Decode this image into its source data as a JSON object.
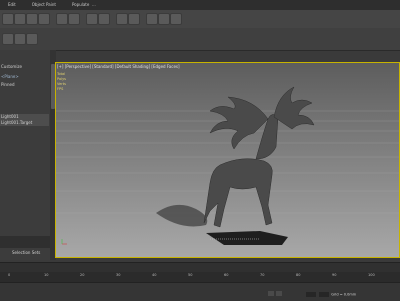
{
  "ribbon": {
    "tabs": [
      "Edit",
      "Object Paint",
      "Populate"
    ],
    "more": "..."
  },
  "command_panel": {
    "header": "Customize",
    "items": [
      "<Plane>",
      "Pinned"
    ],
    "objects": [
      "Light001",
      "Light001.Target"
    ],
    "selection_label": "Selection Sets"
  },
  "viewport": {
    "label": "[+] [Perspective] [Standard] [Default Shading] [Edged Faces]",
    "stats": [
      "Total",
      "Polys",
      "Verts",
      "FPS"
    ]
  },
  "timeline": {
    "ticks": [
      "0",
      "10",
      "20",
      "30",
      "40",
      "50",
      "60",
      "70",
      "80",
      "90",
      "100"
    ]
  },
  "status": {
    "grid": "Grid = 0.0mm",
    "auto_key": "Auto Key"
  }
}
